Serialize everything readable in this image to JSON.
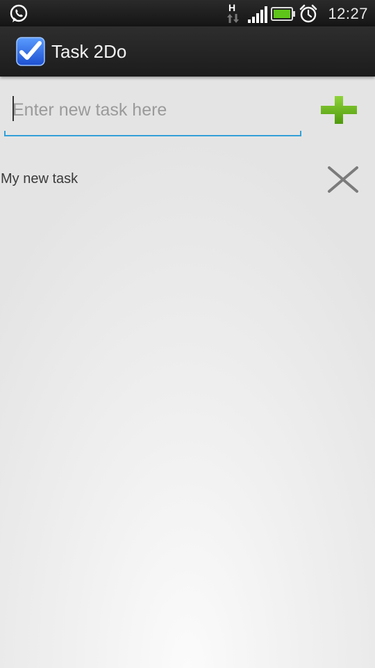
{
  "status_bar": {
    "time": "12:27",
    "network_label": "H",
    "icons": [
      "whatsapp-icon",
      "network-h-icon",
      "signal-icon",
      "battery-icon",
      "alarm-icon"
    ]
  },
  "app": {
    "title": "Task 2Do",
    "icon": "checkbox-app-icon"
  },
  "new_task": {
    "value": "",
    "placeholder": "Enter new task here",
    "add_icon": "plus-icon"
  },
  "tasks": [
    {
      "label": "My new task",
      "delete_icon": "close-icon"
    }
  ],
  "colors": {
    "accent_blue": "#33a0d8",
    "add_green": "#6ab516",
    "battery_green": "#5fc41a",
    "action_bar": "#232323"
  }
}
